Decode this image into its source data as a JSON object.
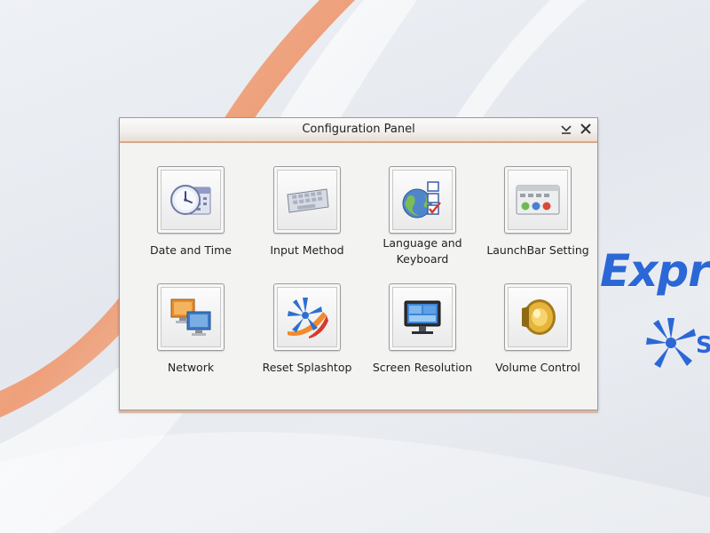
{
  "window": {
    "title": "Configuration Panel"
  },
  "title_bar": {
    "minimize_icon": "chevron-down-icon",
    "close_icon": "close-icon"
  },
  "items": [
    {
      "label": "Date and Time",
      "icon": "clock-calendar-icon"
    },
    {
      "label": "Input Method",
      "icon": "keyboard-icon"
    },
    {
      "label": "Language and Keyboard",
      "icon": "globe-checklist-icon"
    },
    {
      "label": "LaunchBar Setting",
      "icon": "launchbar-icon"
    },
    {
      "label": "Network",
      "icon": "network-computers-icon"
    },
    {
      "label": "Reset Splashtop",
      "icon": "splashtop-logo-icon"
    },
    {
      "label": "Screen Resolution",
      "icon": "monitor-icon"
    },
    {
      "label": "Volume Control",
      "icon": "speaker-icon"
    }
  ],
  "wallpaper": {
    "brand_text": "Expr",
    "brand_letter": "S"
  },
  "colors": {
    "accent_orange": "#e8a27e",
    "brand_blue": "#2b67d6",
    "window_bg": "#f3f3f2"
  }
}
